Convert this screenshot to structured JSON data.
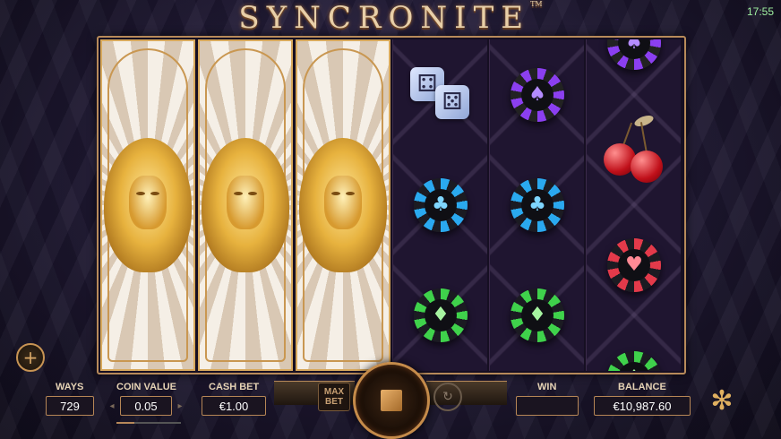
{
  "header": {
    "title": "SYNCRONITE",
    "trademark": "TM",
    "clock": "17:55"
  },
  "reels": [
    {
      "type": "lion",
      "symbol": "lion-wild"
    },
    {
      "type": "lion",
      "symbol": "lion-wild"
    },
    {
      "type": "lion",
      "symbol": "lion-wild"
    },
    {
      "type": "normal",
      "symbols": [
        "dice",
        "club-chip-blue",
        "diamond-chip-green"
      ]
    },
    {
      "type": "normal",
      "symbols": [
        "spade-chip-purple",
        "club-chip-blue",
        "diamond-chip-green"
      ]
    },
    {
      "type": "normal",
      "symbols": [
        "spade-chip-purple",
        "cherries",
        "heart-chip-red",
        "diamond-chip-green"
      ]
    }
  ],
  "glyphs": {
    "spade": "♠",
    "club": "♣",
    "diamond": "♦",
    "heart": "♥",
    "plus": "+",
    "die_face_a": "⚃",
    "die_face_b": "⚄",
    "autoplay": "↻",
    "logo": "✻",
    "left_arrow": "◂",
    "right_arrow": "▸"
  },
  "controls": {
    "ways_label": "WAYS",
    "ways_value": "729",
    "coin_value_label": "COIN VALUE",
    "coin_value": "0.05",
    "cash_bet_label": "CASH BET",
    "cash_bet_value": "€1.00",
    "max_bet_line1": "MAX",
    "max_bet_line2": "BET",
    "win_label": "WIN",
    "win_value": "",
    "balance_label": "BALANCE",
    "balance_value": "€10,987.60"
  },
  "colors": {
    "gold": "#c89454",
    "chip_purple": "#8b3ff0",
    "chip_blue": "#2aa9ef",
    "chip_green": "#3fd24b",
    "chip_red": "#e33a4a",
    "clock": "#9ff0a0"
  }
}
